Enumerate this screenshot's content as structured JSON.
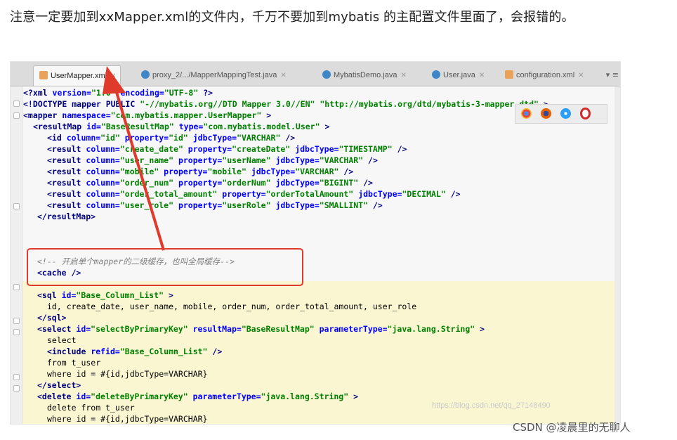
{
  "article": {
    "sentence": "注意一定要加到xxMapper.xml的文件内，千万不要加到mybatis 的主配置文件里面了，会报错的。"
  },
  "tabs": [
    {
      "label": "UserMapper.xml",
      "active": true,
      "icon": "xml-file-icon"
    },
    {
      "label": "proxy_2/.../MapperMappingTest.java",
      "active": false,
      "icon": "java-class-icon"
    },
    {
      "label": "MybatisDemo.java",
      "active": false,
      "icon": "java-class-icon"
    },
    {
      "label": "User.java",
      "active": false,
      "icon": "java-class-icon"
    },
    {
      "label": "configuration.xml",
      "active": false,
      "icon": "xml-file-icon"
    }
  ],
  "tab_overflow": "▾ ≡",
  "code": {
    "line1": {
      "a": "<?xml ",
      "b": "version=",
      "c": "\"1.0\"",
      "d": " encoding=",
      "e": "\"UTF-8\"",
      "f": " ?>"
    },
    "line2": {
      "a": "<!DOCTYPE ",
      "b": "mapper ",
      "c": "PUBLIC ",
      "d": "\"-//mybatis.org//DTD Mapper 3.0//EN\" \"http://mybatis.org/dtd/mybatis-3-mapper.dtd\"",
      "e": " >"
    },
    "line3": {
      "a": "<mapper ",
      "b": "namespace=",
      "c": "\"com.mybatis.mapper.UserMapper\"",
      "d": " >"
    },
    "line4": {
      "a": "<resultMap ",
      "b": "id=",
      "c": "\"BaseResultMap\"",
      "d": " type=",
      "e": "\"com.mybatis.model.User\"",
      "f": " >"
    },
    "line5": {
      "a": "<id ",
      "b": "column=",
      "c": "\"id\"",
      "d": " property=",
      "e": "\"id\"",
      "f": " jdbcType=",
      "g": "\"VARCHAR\"",
      "h": " />"
    },
    "line6": {
      "a": "<result ",
      "b": "column=",
      "c": "\"create_date\"",
      "d": " property=",
      "e": "\"createDate\"",
      "f": " jdbcType=",
      "g": "\"TIMESTAMP\"",
      "h": " />"
    },
    "line7": {
      "a": "<result ",
      "b": "column=",
      "c": "\"user_name\"",
      "d": " property=",
      "e": "\"userName\"",
      "f": " jdbcType=",
      "g": "\"VARCHAR\"",
      "h": " />"
    },
    "line8": {
      "a": "<result ",
      "b": "column=",
      "c": "\"mobile\"",
      "d": " property=",
      "e": "\"mobile\"",
      "f": " jdbcType=",
      "g": "\"VARCHAR\"",
      "h": " />"
    },
    "line9": {
      "a": "<result ",
      "b": "column=",
      "c": "\"order_num\"",
      "d": " property=",
      "e": "\"orderNum\"",
      "f": " jdbcType=",
      "g": "\"BIGINT\"",
      "h": " />"
    },
    "line10": {
      "a": "<result ",
      "b": "column=",
      "c": "\"order_total_amount\"",
      "d": " property=",
      "e": "\"orderTotalAmount\"",
      "f": " jdbcType=",
      "g": "\"DECIMAL\"",
      "h": " />"
    },
    "line11": {
      "a": "<result ",
      "b": "column=",
      "c": "\"user_role\"",
      "d": " property=",
      "e": "\"userRole\"",
      "f": " jdbcType=",
      "g": "\"SMALLINT\"",
      "h": " />"
    },
    "line12": {
      "a": "</resultMap>"
    },
    "line13": {
      "a": "<!-- 开启单个mapper的二级缓存，也叫全局缓存-->"
    },
    "line14": {
      "a": "<cache />"
    },
    "line15": {
      "a": "<sql ",
      "b": "id=",
      "c": "\"Base_Column_List\"",
      "d": " >"
    },
    "line16": {
      "a": "id, create_date, user_name, mobile, order_num, order_total_amount, user_role"
    },
    "line17": {
      "a": "</sql>"
    },
    "line18": {
      "a": "<select ",
      "b": "id=",
      "c": "\"selectByPrimaryKey\"",
      "d": " resultMap=",
      "e": "\"BaseResultMap\"",
      "f": " parameterType=",
      "g": "\"java.lang.String\"",
      "h": " >"
    },
    "line19": {
      "a": "select"
    },
    "line20": {
      "a": "<include ",
      "b": "refid=",
      "c": "\"Base_Column_List\"",
      "d": " />"
    },
    "line21": {
      "a": "from t_user"
    },
    "line22": {
      "a": "where id = #{id,jdbcType=VARCHAR}"
    },
    "line23": {
      "a": "</select>"
    },
    "line24": {
      "a": "<delete ",
      "b": "id=",
      "c": "\"deleteByPrimaryKey\"",
      "d": " parameterType=",
      "e": "\"java.lang.String\"",
      "f": " >"
    },
    "line25": {
      "a": "delete from t_user"
    },
    "line26": {
      "a": "where id = #{id,jdbcType=VARCHAR}"
    }
  },
  "browser_icons": [
    "chrome-icon",
    "firefox-icon",
    "safari-icon",
    "opera-icon"
  ],
  "faint_watermark": "https://blog.csdn.net/qq_27148490",
  "watermark": "CSDN @凌晨里的无聊人",
  "colors": {
    "annotation_red": "#e03a2c",
    "tag": "#000080",
    "attr": "#0000ff",
    "value": "#008000",
    "comment": "#808080",
    "highlight": "#fbf6d2"
  }
}
